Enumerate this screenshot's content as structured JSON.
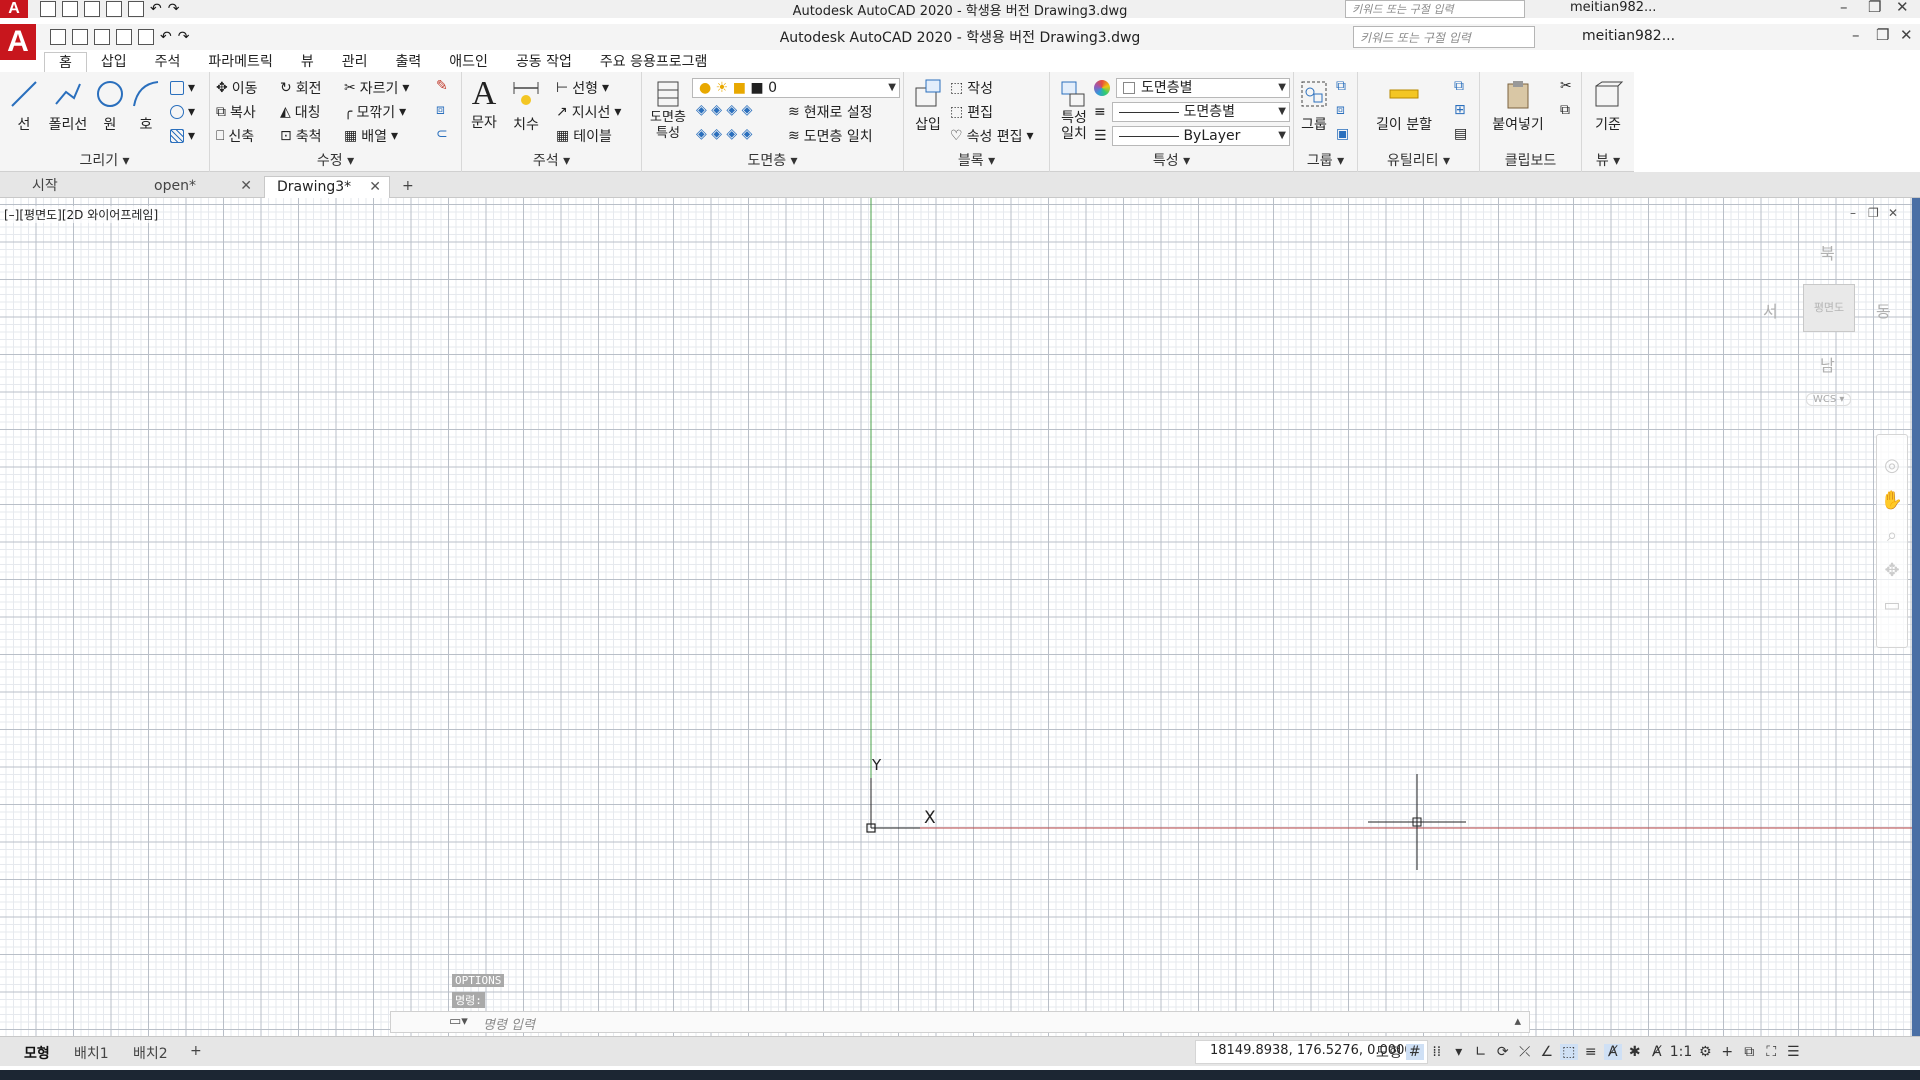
{
  "window": {
    "title_outer": "Autodesk AutoCAD 2020 - 학생용 버전    Drawing3.dwg",
    "title_inner": "Autodesk AutoCAD 2020 - 학생용 버전    Drawing3.dwg",
    "search_placeholder": "키워드 또는 구절 입력",
    "user": "meitian982...",
    "app_letter": "A"
  },
  "menu_tabs": [
    "홈",
    "삽입",
    "주석",
    "파라메트릭",
    "뷰",
    "관리",
    "출력",
    "애드인",
    "공동 작업",
    "주요 응용프로그램"
  ],
  "ribbon": {
    "draw": {
      "title": "그리기",
      "line": "선",
      "polyline": "폴리선",
      "circle": "원",
      "arc": "호"
    },
    "modify": {
      "title": "수정",
      "move": "이동",
      "rotate": "회전",
      "trim": "자르기",
      "copy": "복사",
      "mirror": "대칭",
      "fillet": "모깎기",
      "stretch": "신축",
      "scale": "축척",
      "array": "배열"
    },
    "annotation": {
      "title": "주석",
      "text": "문자",
      "dimension": "치수",
      "linear": "선형",
      "leader": "지시선",
      "table": "테이블"
    },
    "layers": {
      "title": "도면층",
      "properties": "도면층\n특성",
      "current_layer": "0",
      "make_current": "현재로 설정",
      "match_layer": "도면층 일치"
    },
    "block": {
      "title": "블록",
      "insert": "삽입",
      "create": "작성",
      "edit": "편집",
      "edit_attributes": "속성 편집"
    },
    "properties": {
      "title": "특성",
      "match": "특성\n일치",
      "color": "도면층별",
      "linetype": "도면층별",
      "lineweight": "ByLayer"
    },
    "groups": {
      "title": "그룹",
      "group": "그룹"
    },
    "utilities": {
      "title": "유틸리티",
      "measure": "길이 분할"
    },
    "clipboard": {
      "title": "클립보드",
      "paste": "붙여넣기"
    },
    "view": {
      "title": "뷰",
      "base": "기준"
    }
  },
  "doc_tabs": [
    {
      "label": "시작"
    },
    {
      "label": "open*"
    },
    {
      "label": "Drawing3*"
    }
  ],
  "viewport_label": "[–][평면도][2D 와이어프레임]",
  "viewcube": {
    "north": "북",
    "south": "남",
    "east": "동",
    "west": "서",
    "face": "평면도",
    "wcs": "WCS"
  },
  "ucs": {
    "y": "Y",
    "x": "X"
  },
  "command": {
    "history1": "OPTIONS",
    "history2": "명령:",
    "placeholder": "명령 입력"
  },
  "layout_tabs": [
    "모형",
    "배치1",
    "배치2"
  ],
  "status": {
    "coords": "18149.8938, 176.5276, 0.0000",
    "model": "모형",
    "scale": "1:1"
  }
}
